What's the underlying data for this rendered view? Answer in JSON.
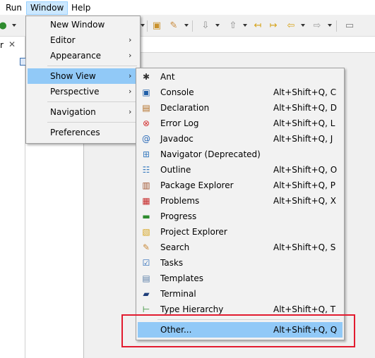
{
  "menubar": {
    "items": [
      "Run",
      "Window",
      "Help"
    ]
  },
  "left_tab": {
    "label": "r",
    "close": "✕"
  },
  "window_menu": {
    "items": [
      {
        "label": "New Window",
        "submenu": false
      },
      {
        "label": "Editor",
        "submenu": true
      },
      {
        "label": "Appearance",
        "submenu": true
      },
      {
        "label": "Show View",
        "submenu": true,
        "highlighted": true
      },
      {
        "label": "Perspective",
        "submenu": true
      },
      {
        "label": "Navigation",
        "submenu": true
      },
      {
        "label": "Preferences",
        "submenu": false
      }
    ],
    "arrow": "›"
  },
  "show_view_menu": {
    "items": [
      {
        "label": "Ant",
        "shortcut": "",
        "icon": "ant-icon"
      },
      {
        "label": "Console",
        "shortcut": "Alt+Shift+Q, C",
        "icon": "console-icon"
      },
      {
        "label": "Declaration",
        "shortcut": "Alt+Shift+Q, D",
        "icon": "declaration-icon"
      },
      {
        "label": "Error Log",
        "shortcut": "Alt+Shift+Q, L",
        "icon": "error-log-icon"
      },
      {
        "label": "Javadoc",
        "shortcut": "Alt+Shift+Q, J",
        "icon": "javadoc-icon"
      },
      {
        "label": "Navigator (Deprecated)",
        "shortcut": "",
        "icon": "navigator-icon"
      },
      {
        "label": "Outline",
        "shortcut": "Alt+Shift+Q, O",
        "icon": "outline-icon"
      },
      {
        "label": "Package Explorer",
        "shortcut": "Alt+Shift+Q, P",
        "icon": "package-explorer-icon"
      },
      {
        "label": "Problems",
        "shortcut": "Alt+Shift+Q, X",
        "icon": "problems-icon"
      },
      {
        "label": "Progress",
        "shortcut": "",
        "icon": "progress-icon"
      },
      {
        "label": "Project Explorer",
        "shortcut": "",
        "icon": "project-explorer-icon"
      },
      {
        "label": "Search",
        "shortcut": "Alt+Shift+Q, S",
        "icon": "search-icon"
      },
      {
        "label": "Tasks",
        "shortcut": "",
        "icon": "tasks-icon"
      },
      {
        "label": "Templates",
        "shortcut": "",
        "icon": "templates-icon"
      },
      {
        "label": "Terminal",
        "shortcut": "",
        "icon": "terminal-icon"
      },
      {
        "label": "Type Hierarchy",
        "shortcut": "Alt+Shift+Q, T",
        "icon": "type-hierarchy-icon"
      },
      {
        "label": "Other...",
        "shortcut": "Alt+Shift+Q, Q",
        "icon": "",
        "highlighted": true
      }
    ]
  },
  "colors": {
    "highlight": "#91c9f7",
    "menu_bg": "#f2f2f2",
    "annotation": "#e21b2f",
    "menubar_active": "#cce8ff"
  }
}
